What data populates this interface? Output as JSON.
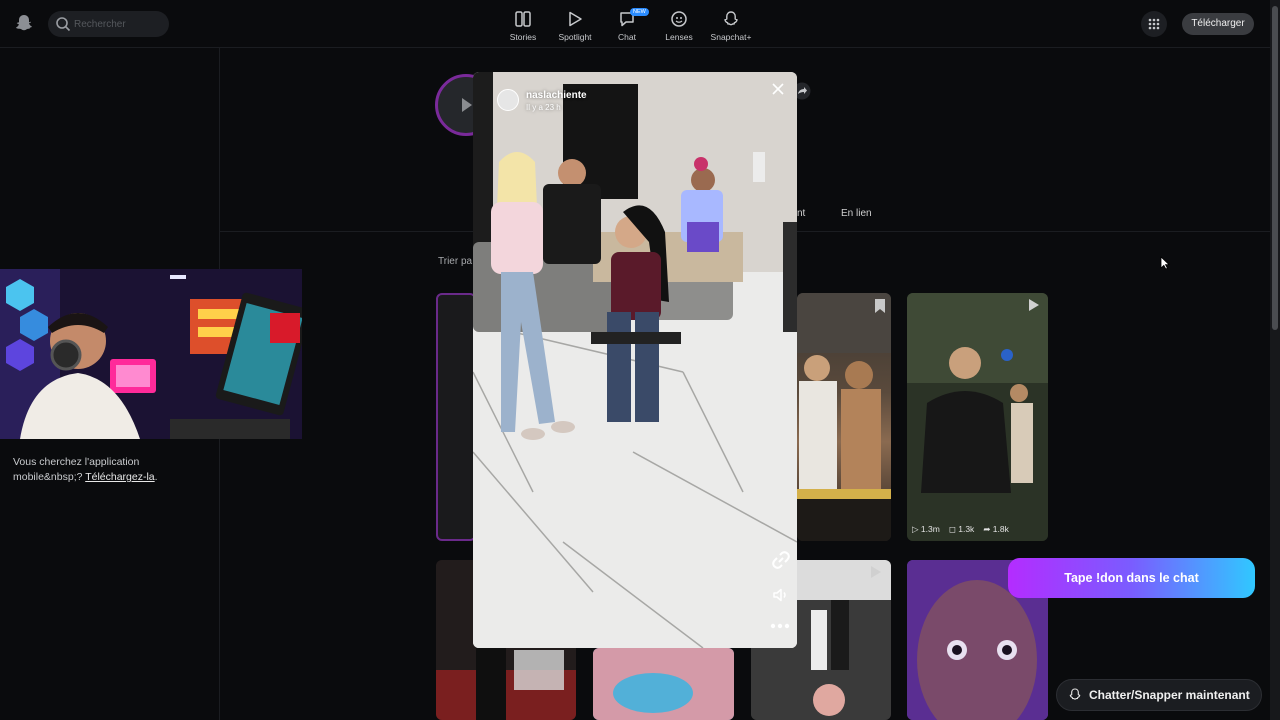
{
  "search": {
    "placeholder": "Rechercher"
  },
  "nav": [
    {
      "label": "Stories",
      "icon": "stories-icon"
    },
    {
      "label": "Spotlight",
      "icon": "play-icon"
    },
    {
      "label": "Chat",
      "icon": "chat-icon",
      "badge": "NEW"
    },
    {
      "label": "Lenses",
      "icon": "lens-icon"
    },
    {
      "label": "Snapchat+",
      "icon": "ghost-plus-icon"
    }
  ],
  "header": {
    "download_label": "Télécharger"
  },
  "profile": {
    "tab_partial": "nt",
    "tab_en_lien": "En lien",
    "sort_partial": "Trier pa"
  },
  "sidebar": {
    "app_message": "Vous cherchez l'application mobile&nbsp;? ",
    "app_link": "Téléchargez-la",
    "app_suffix": "."
  },
  "modal": {
    "username": "naslachiente",
    "time": "Il y a 23 h"
  },
  "tile_stats": {
    "views": "1.3m",
    "comments": "1.3k",
    "shares": "1.8k"
  },
  "overlay": {
    "cta": "Tape !don dans le chat"
  },
  "chat_now": {
    "label": "Chatter/Snapper maintenant"
  },
  "colors": {
    "accent": "#7a2a9a",
    "cta_start": "#b42cff",
    "cta_end": "#30c8ff"
  }
}
